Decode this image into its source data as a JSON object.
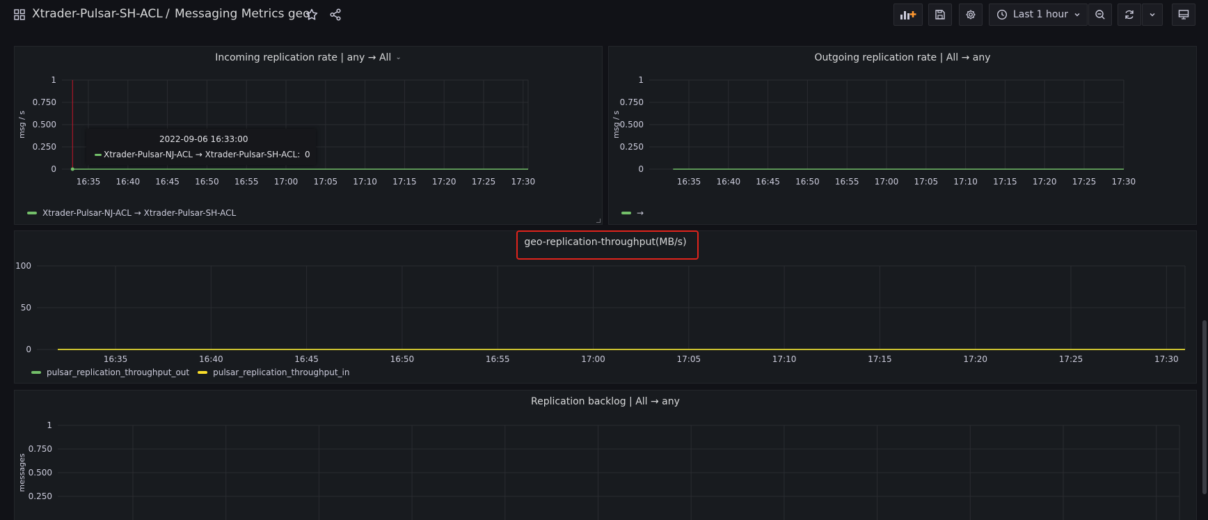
{
  "header": {
    "folder": "Xtrader-Pulsar-SH-ACL",
    "separator": "/",
    "dashboard_title": "Messaging Metrics geo",
    "time_range": "Last 1 hour"
  },
  "icons": {
    "dashboards": "grid-icon",
    "star": "star-icon",
    "share": "share-icon",
    "add_panel": "add-panel-icon",
    "save": "save-icon",
    "settings": "gear-icon",
    "clock": "clock-icon",
    "zoom_out": "zoom-out-icon",
    "refresh": "refresh-icon",
    "tv_mode": "monitor-icon"
  },
  "colors": {
    "green": "#73bf69",
    "yellow": "#fade2a",
    "cursor": "#c4162a",
    "highlight": "#e0241c"
  },
  "x_ticks": [
    "16:35",
    "16:40",
    "16:45",
    "16:50",
    "16:55",
    "17:00",
    "17:05",
    "17:10",
    "17:15",
    "17:20",
    "17:25",
    "17:30"
  ],
  "panels": {
    "incoming": {
      "title": "Incoming replication rate | any → All",
      "legend": [
        "Xtrader-Pulsar-NJ-ACL → Xtrader-Pulsar-SH-ACL"
      ],
      "tooltip": {
        "time": "2022-09-06 16:33:00",
        "series": "Xtrader-Pulsar-NJ-ACL → Xtrader-Pulsar-SH-ACL:",
        "value": "0"
      }
    },
    "outgoing": {
      "title": "Outgoing replication rate | All → any",
      "legend": [
        "→"
      ]
    },
    "throughput": {
      "title": "geo-replication-throughput(MB/s)",
      "legend": [
        "pulsar_replication_throughput_out",
        "pulsar_replication_throughput_in"
      ]
    },
    "backlog": {
      "title": "Replication backlog | All → any"
    }
  },
  "chart_data": [
    {
      "type": "line",
      "title": "Incoming replication rate | any → All",
      "ylabel": "msg / s",
      "ylim": [
        0,
        1
      ],
      "y_ticks": [
        "0",
        "0.250",
        "0.500",
        "0.750",
        "1"
      ],
      "x": [
        "16:33",
        "17:32"
      ],
      "series": [
        {
          "name": "Xtrader-Pulsar-NJ-ACL → Xtrader-Pulsar-SH-ACL",
          "color": "#73bf69",
          "values": [
            0,
            0
          ]
        }
      ],
      "grid": true,
      "legend": "bottom-left"
    },
    {
      "type": "line",
      "title": "Outgoing replication rate | All → any",
      "ylabel": "msg / s",
      "ylim": [
        0,
        1
      ],
      "y_ticks": [
        "0",
        "0.250",
        "0.500",
        "0.750",
        "1"
      ],
      "x": [
        "16:33",
        "17:32"
      ],
      "series": [
        {
          "name": "→",
          "color": "#73bf69",
          "values": [
            0,
            0
          ]
        }
      ],
      "grid": true,
      "legend": "bottom-left"
    },
    {
      "type": "line",
      "title": "geo-replication-throughput(MB/s)",
      "ylim": [
        0,
        100
      ],
      "y_ticks": [
        "0",
        "50",
        "100"
      ],
      "x": [
        "16:33",
        "17:32"
      ],
      "series": [
        {
          "name": "pulsar_replication_throughput_out",
          "color": "#73bf69",
          "values": [
            0,
            0
          ]
        },
        {
          "name": "pulsar_replication_throughput_in",
          "color": "#fade2a",
          "values": [
            0,
            0
          ]
        }
      ],
      "grid": true,
      "legend": "bottom-left"
    },
    {
      "type": "line",
      "title": "Replication backlog | All → any",
      "ylabel": "messages",
      "ylim": [
        0,
        1
      ],
      "y_ticks": [
        "0.250",
        "0.500",
        "0.750",
        "1"
      ],
      "grid": true
    }
  ]
}
